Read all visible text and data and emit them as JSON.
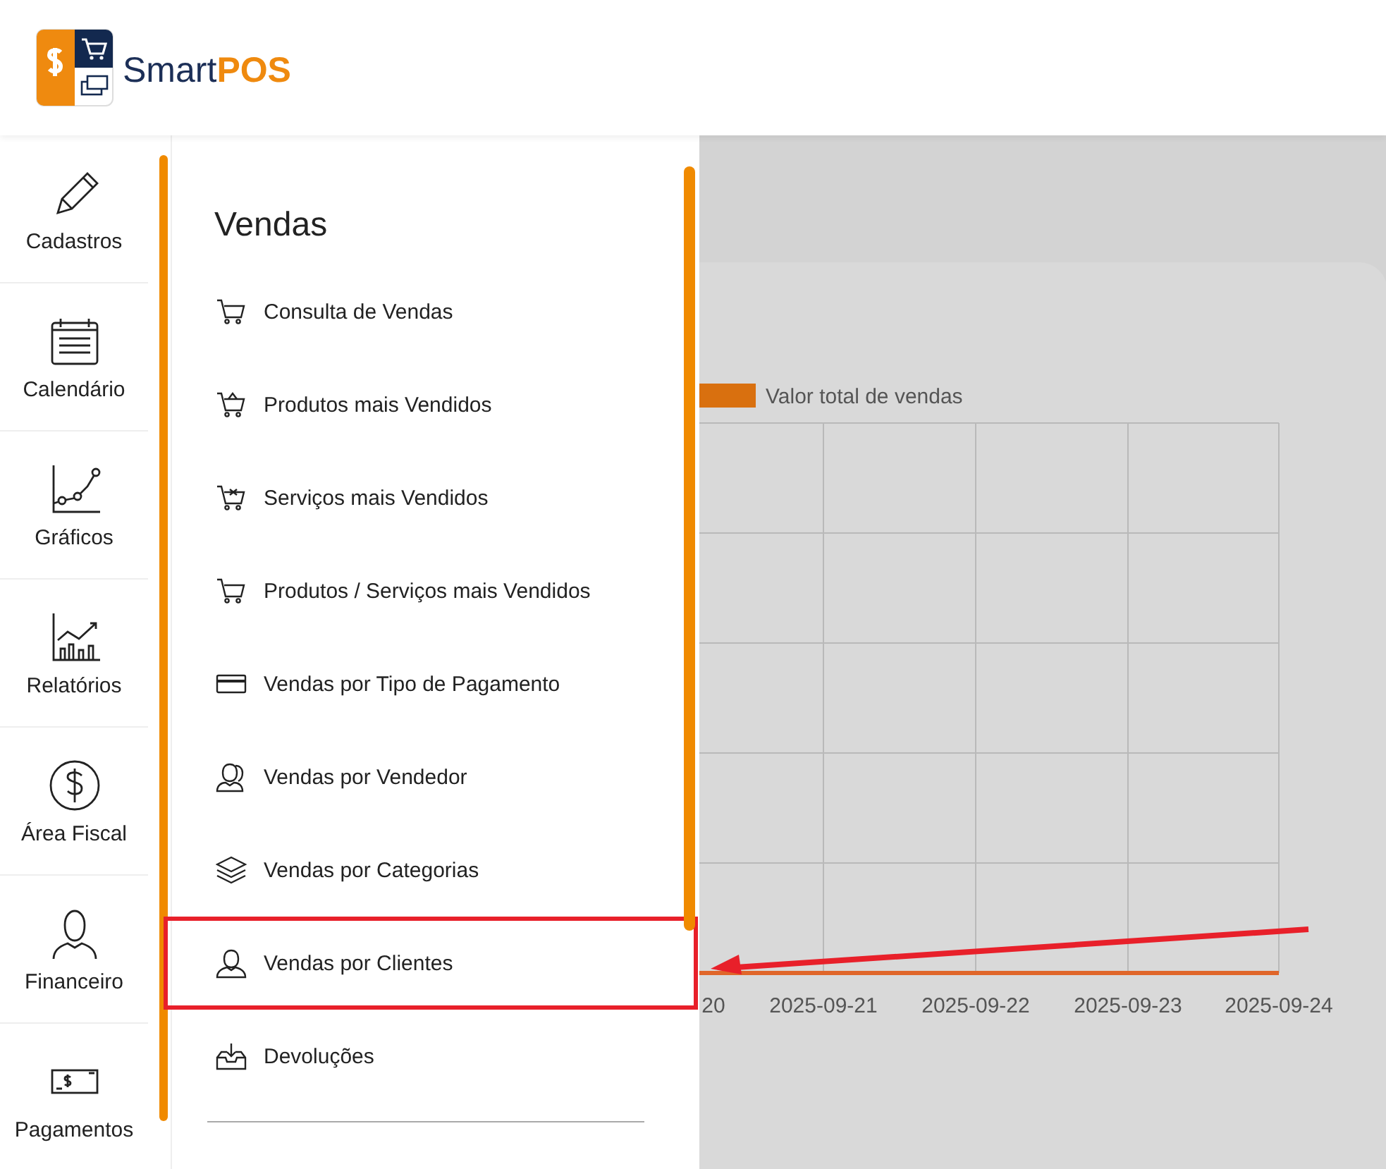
{
  "header": {
    "brand": "Smart**POS**"
  },
  "rail": {
    "items": [
      {
        "label": "Cadastros"
      },
      {
        "label": "Calendário"
      },
      {
        "label": "Gráficos"
      },
      {
        "label": "Relatórios"
      },
      {
        "label": "Área Fiscal"
      },
      {
        "label": "Financeiro"
      },
      {
        "label": "Pagamentos"
      }
    ]
  },
  "submenu": {
    "title": "Vendas",
    "items": [
      {
        "label": "Consulta de Vendas",
        "highlighted": false
      },
      {
        "label": "Produtos mais Vendidos",
        "highlighted": false
      },
      {
        "label": "Serviços mais Vendidos",
        "highlighted": false
      },
      {
        "label": "Produtos / Serviços mais Vendidos",
        "highlighted": false
      },
      {
        "label": "Vendas por Tipo de Pagamento",
        "highlighted": false
      },
      {
        "label": "Vendas por Vendedor",
        "highlighted": false
      },
      {
        "label": "Vendas por Categorias",
        "highlighted": false
      },
      {
        "label": "Vendas por Clientes",
        "highlighted": true
      },
      {
        "label": "Devoluções",
        "highlighted": false
      }
    ]
  },
  "chart": {
    "legend": {
      "label": "Valor total de vendas"
    },
    "x_labels": [
      "20",
      "2025-09-21",
      "2025-09-22",
      "2025-09-23",
      "2025-09-24"
    ]
  }
}
